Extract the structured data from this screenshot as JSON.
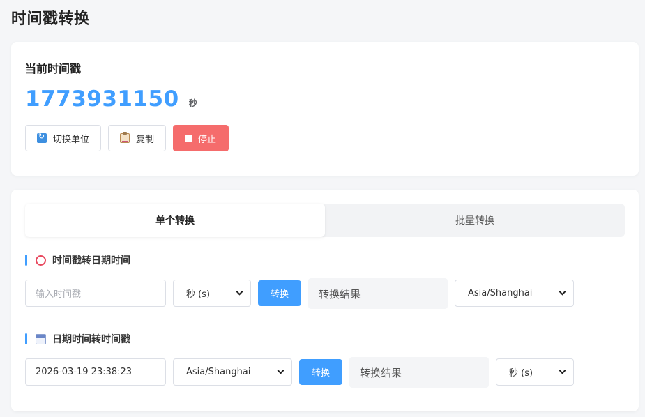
{
  "page": {
    "title": "时间戳转换"
  },
  "current": {
    "title": "当前时间戳",
    "timestamp": "1773931150",
    "unit": "秒",
    "buttons": {
      "switch_unit": "切换单位",
      "copy": "复制",
      "stop": "停止"
    },
    "colors": {
      "accent": "#409eff",
      "danger": "#f56c6c"
    }
  },
  "tabs": [
    {
      "label": "单个转换",
      "active": true
    },
    {
      "label": "批量转换",
      "active": false
    }
  ],
  "ts_to_date": {
    "title": "时间戳转日期时间",
    "input_placeholder": "输入时间戳",
    "unit_select": "秒 (s)",
    "convert_label": "转换",
    "result": "转换结果",
    "timezone": "Asia/Shanghai"
  },
  "date_to_ts": {
    "title": "日期时间转时间戳",
    "input_value": "2026-03-19 23:38:23",
    "timezone": "Asia/Shanghai",
    "convert_label": "转换",
    "result": "转换结果",
    "unit_select": "秒 (s)"
  }
}
